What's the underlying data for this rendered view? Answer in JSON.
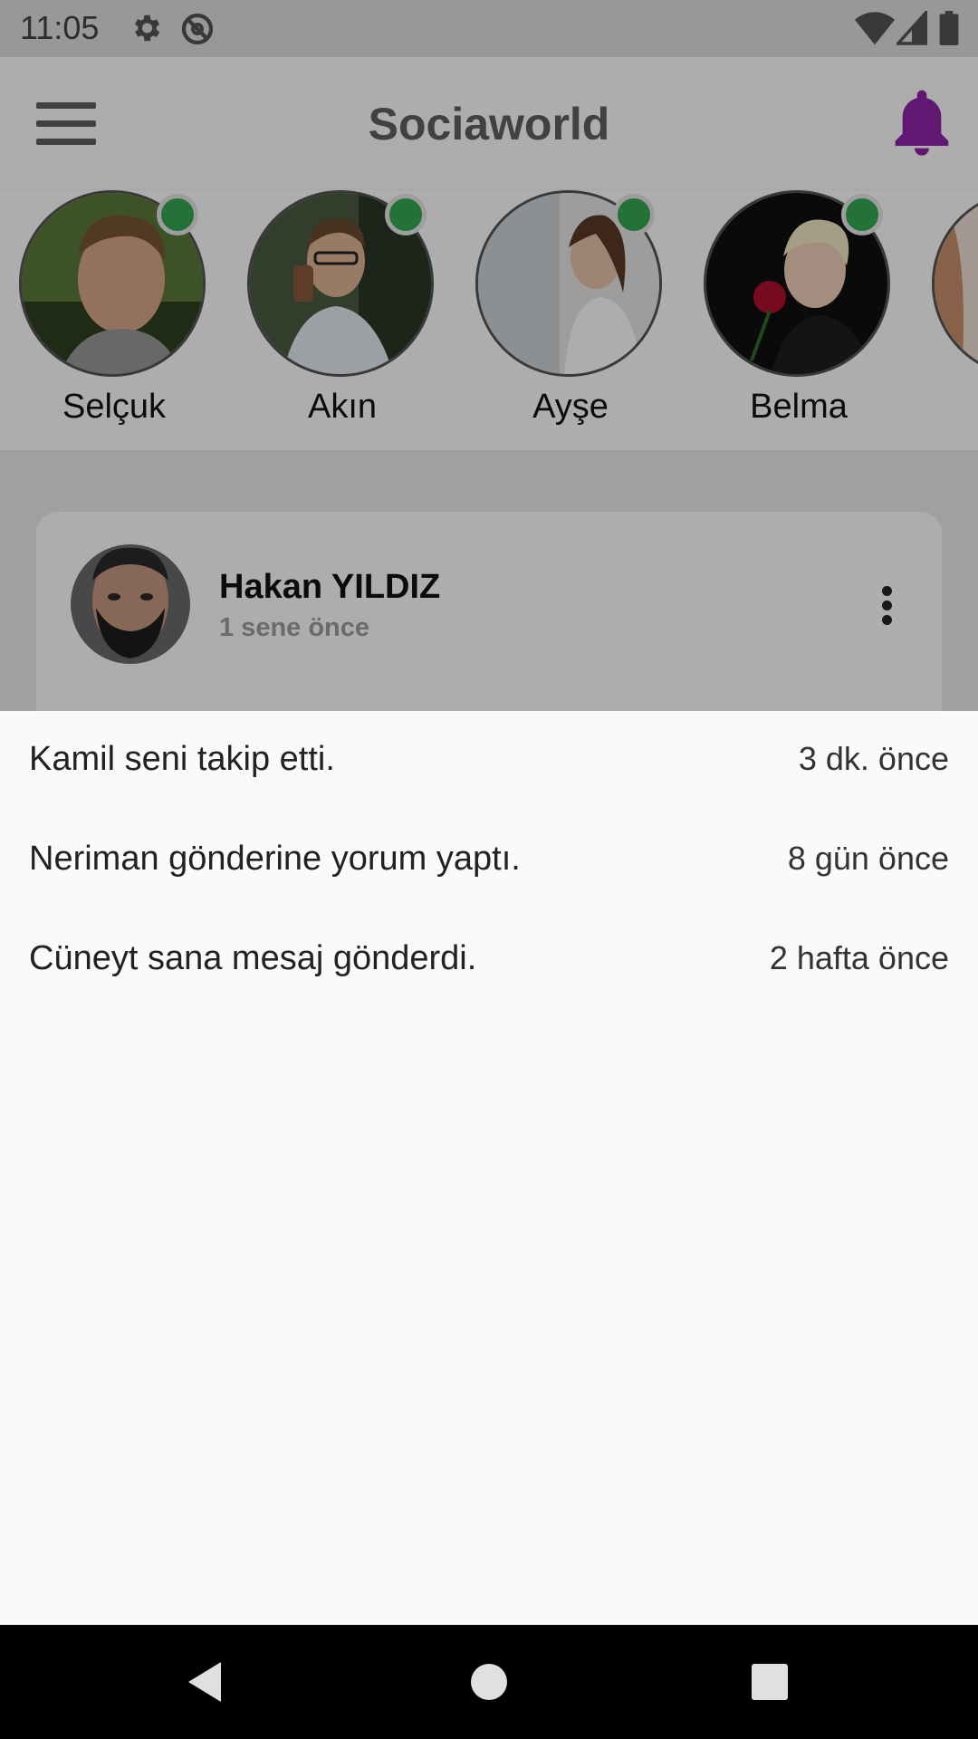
{
  "status_bar": {
    "time": "11:05",
    "icons": [
      "settings-icon",
      "no-sync-icon",
      "wifi-icon",
      "signal-icon",
      "battery-icon"
    ]
  },
  "app_bar": {
    "title": "Sociaworld",
    "menu_icon": "hamburger-menu-icon",
    "bell_icon": "notification-bell-icon",
    "bell_color": "#8e24aa"
  },
  "stories": [
    {
      "name": "Selçuk",
      "online": true
    },
    {
      "name": "Akın",
      "online": true
    },
    {
      "name": "Ayşe",
      "online": true
    },
    {
      "name": "Belma",
      "online": true
    },
    {
      "name": "",
      "online": false
    }
  ],
  "post": {
    "author": "Hakan YILDIZ",
    "time": "1 sene önce",
    "more_icon": "more-vert-icon"
  },
  "notifications": [
    {
      "text": "Kamil seni takip etti.",
      "time": "3 dk. önce"
    },
    {
      "text": "Neriman gönderine yorum yaptı.",
      "time": "8 gün önce"
    },
    {
      "text": "Cüneyt sana mesaj gönderdi.",
      "time": "2 hafta önce"
    }
  ],
  "nav_bar": {
    "back": "back-triangle-icon",
    "home": "home-circle-icon",
    "recents": "recents-square-icon"
  },
  "colors": {
    "online_dot": "#34a853",
    "accent": "#8e24aa"
  }
}
